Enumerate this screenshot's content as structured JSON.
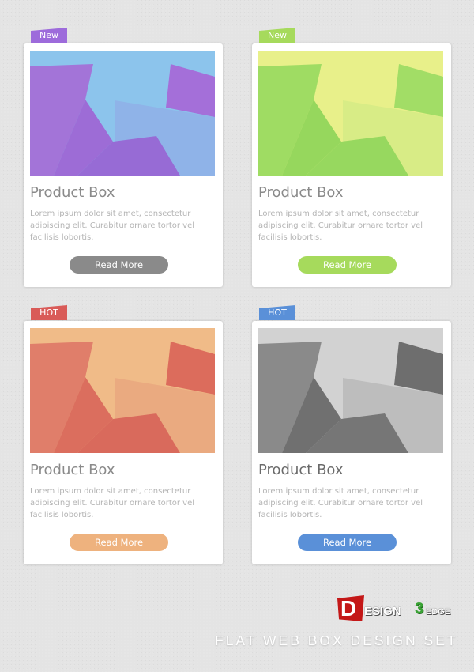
{
  "cards": [
    {
      "tag": "New",
      "title": "Product Box",
      "description": "Lorem ipsum dolor sit amet, consectetur adipiscing elit. Curabitur ornare tortor vel facilisis lobortis.",
      "button": "Read More",
      "colors": {
        "tag": "#9d6bdb",
        "button": "#8a8a8a",
        "title": "#8a8a8a",
        "art_bg": "#8cc4ec",
        "art_a": "#a374d8",
        "art_b": "#9d6cd6",
        "art_c": "#8fb3e8",
        "art_d": "#a46fd9",
        "art_e": "#976bd5"
      }
    },
    {
      "tag": "New",
      "title": "Product Box",
      "description": "Lorem ipsum dolor sit amet, consectetur adipiscing elit. Curabitur ornare tortor vel facilisis lobortis.",
      "button": "Read More",
      "colors": {
        "tag": "#a6da5c",
        "button": "#a6da5c",
        "title": "#8a8a8a",
        "art_bg": "#e8f08a",
        "art_a": "#9fdc63",
        "art_b": "#96d75d",
        "art_c": "#d8ec86",
        "art_d": "#a2dd66",
        "art_e": "#97d85f"
      }
    },
    {
      "tag": "HOT",
      "title": "Product Box",
      "description": "Lorem ipsum dolor sit amet, consectetur adipiscing elit. Curabitur ornare tortor vel facilisis lobortis.",
      "button": "Read More",
      "colors": {
        "tag": "#d95b58",
        "button": "#eeb27e",
        "title": "#8a8a8a",
        "art_bg": "#f0bb88",
        "art_a": "#e07e6a",
        "art_b": "#db6e5e",
        "art_c": "#eaaa80",
        "art_d": "#dc6c5c",
        "art_e": "#d96a5c"
      }
    },
    {
      "tag": "HOT",
      "title": "Product Box",
      "description": "Lorem ipsum dolor sit amet, consectetur adipiscing elit. Curabitur ornare tortor vel facilisis lobortis.",
      "button": "Read More",
      "colors": {
        "tag": "#5a90d8",
        "button": "#5a90d8",
        "title": "#6a6a6a",
        "art_bg": "#d2d2d2",
        "art_a": "#8a8a8a",
        "art_b": "#707070",
        "art_c": "#bdbdbd",
        "art_d": "#6e6e6e",
        "art_e": "#767676"
      }
    }
  ],
  "brand": {
    "logo_letter": "D",
    "logo_word": "ESIGN",
    "logo_number": "3",
    "logo_suffix": "EDGE",
    "logo_color": "#c41818",
    "logo_accent": "#3aa335"
  },
  "footer_title": "FLAT WEB BOX DESIGN SET"
}
